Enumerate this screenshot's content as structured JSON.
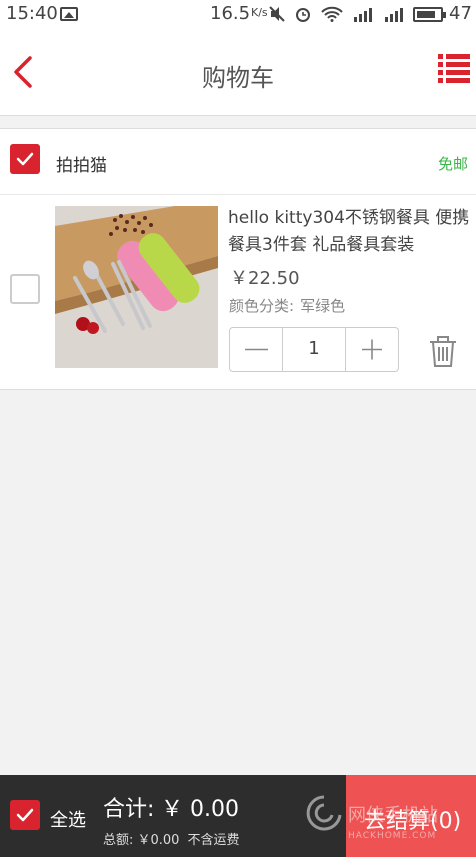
{
  "status_bar": {
    "time": "15:40",
    "speed": "16.5",
    "speed_unit": "K/s",
    "battery_level": "47",
    "icons": [
      "image-icon",
      "mute-icon",
      "alarm-icon",
      "wifi-icon",
      "signal-icon",
      "signal-icon",
      "battery-icon"
    ]
  },
  "header": {
    "title": "购物车",
    "back_icon": "chevron-left-icon",
    "menu_icon": "list-menu-icon"
  },
  "colors": {
    "accent": "#d9232e",
    "free_shipping": "#3bb54a",
    "checkout_bg": "#ee5252",
    "bottom_bar_bg": "#2d2d2d"
  },
  "shop": {
    "selected": true,
    "name": "拍拍猫",
    "shipping": "免邮",
    "items": [
      {
        "selected": false,
        "name": "hello kitty304不锈钢餐具 便携餐具3件套 礼品餐具套装",
        "price": "￥22.50",
        "spec_label": "颜色分类:",
        "spec_value": "军绿色",
        "quantity": "1"
      }
    ]
  },
  "bottom_bar": {
    "select_all_checked": true,
    "select_all_label": "全选",
    "total_label": "合计:",
    "total_amount": "￥ 0.00",
    "subtotal": "总额: ￥0.00",
    "shipping_note": "不含运费",
    "checkout_label": "去结算(0)",
    "watermark_cn": "网侠手机站",
    "watermark_en": "HACKHOME.COM"
  }
}
